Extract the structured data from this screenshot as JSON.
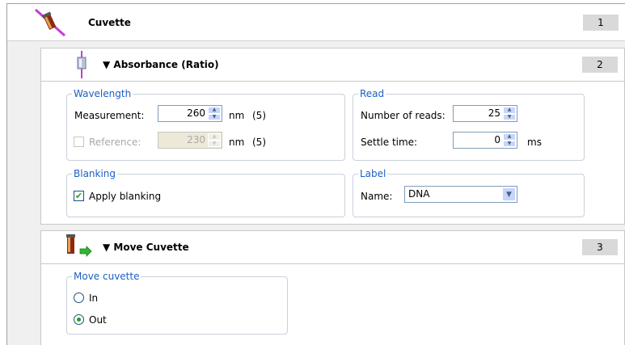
{
  "steps": [
    {
      "title": "Cuvette",
      "number": "1",
      "icon": "cuvette-icon"
    },
    {
      "title": "▼ Absorbance (Ratio)",
      "number": "2",
      "icon": "absorbance-icon"
    },
    {
      "title": "▼ Move Cuvette",
      "number": "3",
      "icon": "move-cuvette-icon"
    }
  ],
  "wavelength": {
    "legend": "Wavelength",
    "measurement_label": "Measurement:",
    "measurement_value": "260",
    "measurement_unit": "nm",
    "measurement_bw": "(5)",
    "reference_label": "Reference:",
    "reference_value": "230",
    "reference_unit": "nm",
    "reference_bw": "(5)",
    "reference_checked": false
  },
  "read": {
    "legend": "Read",
    "reads_label": "Number of reads:",
    "reads_value": "25",
    "settle_label": "Settle time:",
    "settle_value": "0",
    "settle_unit": "ms"
  },
  "blanking": {
    "legend": "Blanking",
    "apply_label": "Apply blanking",
    "apply_checked": true
  },
  "label": {
    "legend": "Label",
    "name_label": "Name:",
    "name_value": "DNA"
  },
  "move_cuvette": {
    "legend": "Move cuvette",
    "options": [
      "In",
      "Out"
    ],
    "selected": "Out"
  },
  "colors": {
    "legend_blue": "#1c5fc4",
    "check_green": "#21a121",
    "step_num_bg": "#d9d9d9"
  }
}
